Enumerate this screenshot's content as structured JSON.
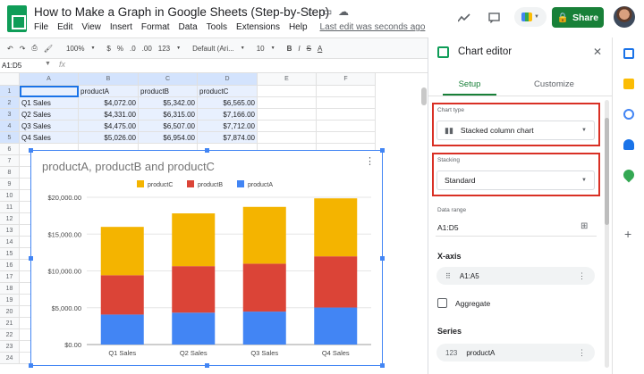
{
  "header": {
    "title": "How to Make a Graph in Google Sheets (Step-by-Step)",
    "menu": [
      "File",
      "Edit",
      "View",
      "Insert",
      "Format",
      "Data",
      "Tools",
      "Extensions",
      "Help"
    ],
    "last_edit": "Last edit was seconds ago",
    "share_label": "Share"
  },
  "toolbar": {
    "zoom": "100%",
    "currency": "$",
    "percent": "%",
    "dec1": ".0",
    "dec2": ".00",
    "number_format": "123",
    "font": "Default (Ari...",
    "font_size": "10",
    "bold": "B",
    "italic": "I",
    "strike": "S",
    "text_color": "A"
  },
  "formula": {
    "cell_ref": "A1:D5",
    "fx": "fx"
  },
  "sheet": {
    "columns": [
      "A",
      "B",
      "C",
      "D",
      "E",
      "F"
    ],
    "rows": [
      "1",
      "2",
      "3",
      "4",
      "5",
      "6",
      "7",
      "8",
      "9",
      "10",
      "11",
      "12",
      "13",
      "14",
      "15",
      "16",
      "17",
      "18",
      "19",
      "20",
      "21",
      "22",
      "23",
      "24"
    ],
    "cells": [
      [
        "",
        "productA",
        "productB",
        "productC"
      ],
      [
        "Q1 Sales",
        "$4,072.00",
        "$5,342.00",
        "$6,565.00"
      ],
      [
        "Q2 Sales",
        "$4,331.00",
        "$6,315.00",
        "$7,166.00"
      ],
      [
        "Q3 Sales",
        "$4,475.00",
        "$6,507.00",
        "$7,712.00"
      ],
      [
        "Q4 Sales",
        "$5,026.00",
        "$6,954.00",
        "$7,874.00"
      ]
    ]
  },
  "chart_data": {
    "type": "bar",
    "stacked": true,
    "title": "productA, productB and productC",
    "categories": [
      "Q1 Sales",
      "Q2 Sales",
      "Q3 Sales",
      "Q4 Sales"
    ],
    "series": [
      {
        "name": "productA",
        "values": [
          4072,
          4331,
          4475,
          5026
        ],
        "color": "#4285f4"
      },
      {
        "name": "productB",
        "values": [
          5342,
          6315,
          6507,
          6954
        ],
        "color": "#db4437"
      },
      {
        "name": "productC",
        "values": [
          6565,
          7166,
          7712,
          7874
        ],
        "color": "#f4b400"
      }
    ],
    "legend_order": [
      "productC",
      "productB",
      "productA"
    ],
    "legend_position": "top",
    "ylim": [
      0,
      20000
    ],
    "yticks": [
      0,
      5000,
      10000,
      15000,
      20000
    ],
    "ytick_labels": [
      "$0.00",
      "$5,000.00",
      "$10,000.00",
      "$15,000.00",
      "$20,000.00"
    ],
    "xlabel": "",
    "ylabel": "",
    "grid": true
  },
  "panel": {
    "title": "Chart editor",
    "tabs": [
      "Setup",
      "Customize"
    ],
    "chart_type_label": "Chart type",
    "chart_type_value": "Stacked column chart",
    "stacking_label": "Stacking",
    "stacking_value": "Standard",
    "data_range_label": "Data range",
    "data_range_value": "A1:D5",
    "xaxis_label": "X-axis",
    "xaxis_value": "A1:A5",
    "aggregate_label": "Aggregate",
    "series_label": "Series",
    "series_value": "productA"
  },
  "colors": {
    "accent": "#188038",
    "highlight": "#d93025",
    "selection": "#4285f4"
  }
}
